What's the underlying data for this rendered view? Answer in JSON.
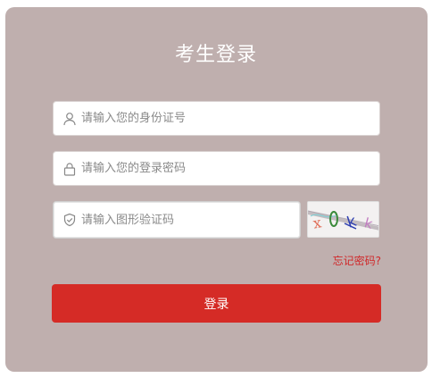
{
  "login": {
    "title": "考生登录",
    "id_placeholder": "请输入您的身份证号",
    "password_placeholder": "请输入您的登录密码",
    "captcha_placeholder": "请输入图形验证码",
    "forgot_label": "忘记密码?",
    "submit_label": "登录"
  },
  "icons": {
    "id": "user-icon",
    "password": "lock-icon",
    "captcha": "shield-icon"
  },
  "colors": {
    "panel": "#bfafae",
    "accent": "#d52b26",
    "link": "#d0282a"
  }
}
